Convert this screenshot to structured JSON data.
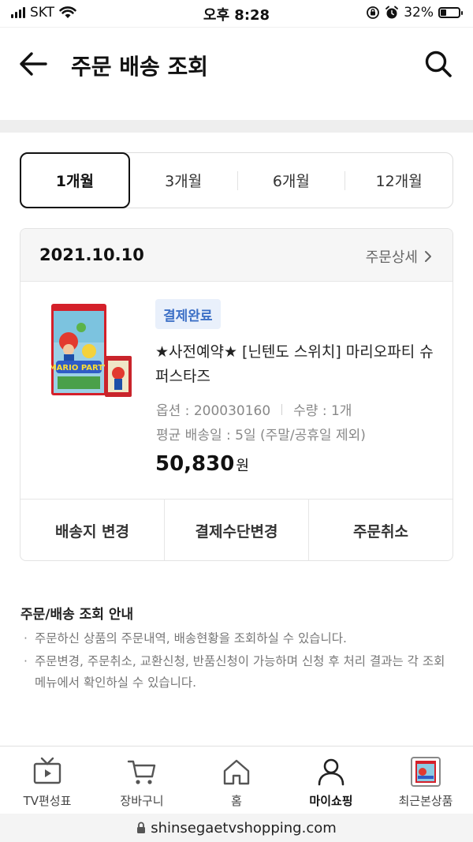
{
  "status_bar": {
    "carrier": "SKT",
    "time": "오후 8:28",
    "battery_percent": "32%",
    "battery_level": 0.32
  },
  "header": {
    "title": "주문 배송 조회"
  },
  "period_tabs": [
    {
      "label": "1개월",
      "active": true
    },
    {
      "label": "3개월",
      "active": false
    },
    {
      "label": "6개월",
      "active": false
    },
    {
      "label": "12개월",
      "active": false
    }
  ],
  "order": {
    "date": "2021.10.10",
    "detail_link": "주문상세",
    "status": "결제완료",
    "product_name": "★사전예약★ [닌텐도 스위치] 마리오파티 슈퍼스타즈",
    "option_label": "옵션 : 200030160",
    "quantity_label": "수량 : 1개",
    "delivery_label": "평균 배송일 : 5일 (주말/공휴일 제외)",
    "price": "50,830",
    "price_unit": "원",
    "thumbnail_logo": "MARIO PARTY",
    "actions": {
      "change_address": "배송지 변경",
      "change_payment": "결제수단변경",
      "cancel_order": "주문취소"
    }
  },
  "guide": {
    "title": "주문/배송 조회 안내",
    "items": [
      "주문하신 상품의 주문내역, 배송현황을 조회하실 수 있습니다.",
      "주문변경, 주문취소, 교환신청, 반품신청이 가능하며 신청 후 처리 결과는 각 조회 메뉴에서 확인하실 수 있습니다."
    ]
  },
  "bottom_nav": [
    {
      "label": "TV편성표",
      "icon": "tv-icon",
      "active": false
    },
    {
      "label": "장바구니",
      "icon": "cart-icon",
      "active": false
    },
    {
      "label": "홈",
      "icon": "home-icon",
      "active": false
    },
    {
      "label": "마이쇼핑",
      "icon": "person-icon",
      "active": true
    },
    {
      "label": "최근본상품",
      "icon": "recent-product-thumbnail",
      "active": false
    }
  ],
  "url_bar": {
    "url": "shinsegaetvshopping.com"
  },
  "colors": {
    "badge_bg": "#e9f0fb",
    "badge_text": "#3d70c6",
    "active_border": "#111111"
  }
}
